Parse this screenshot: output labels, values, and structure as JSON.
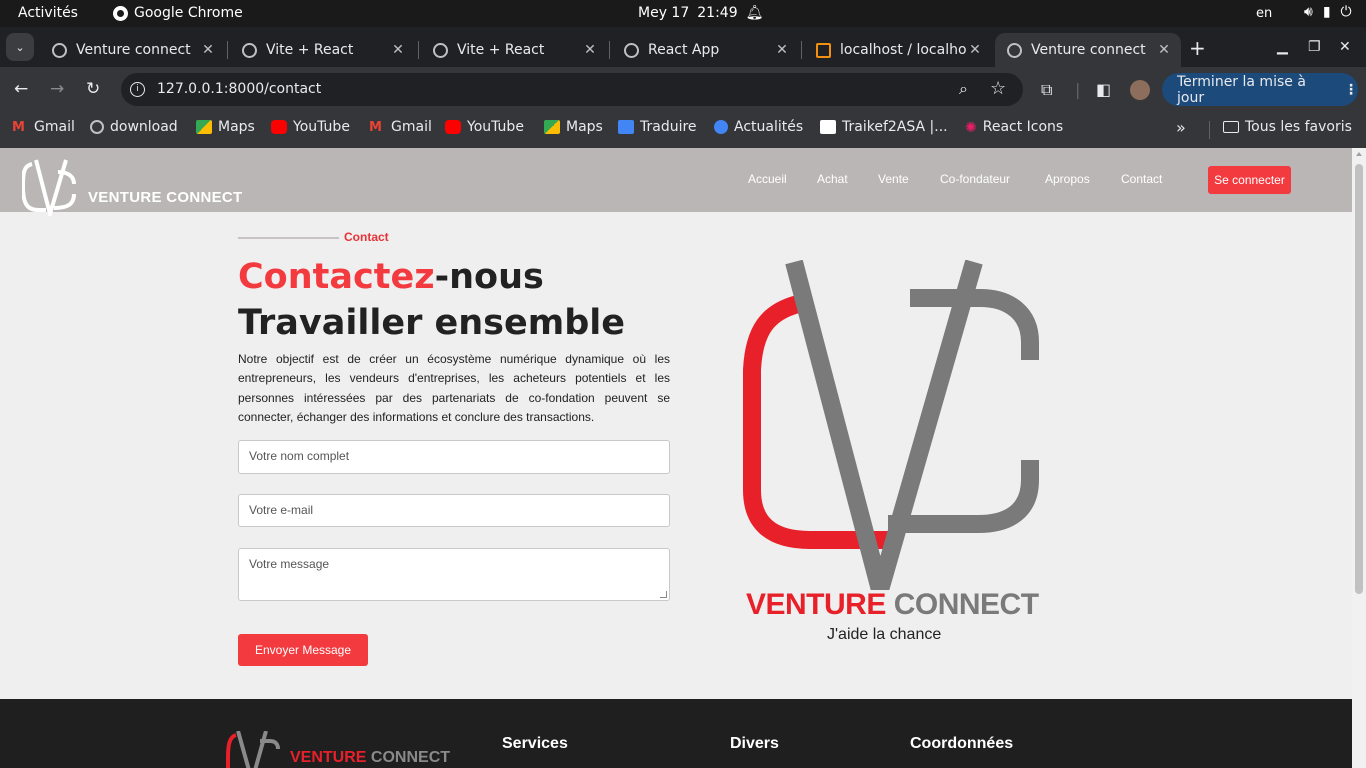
{
  "system": {
    "activities": "Activités",
    "app_name": "Google Chrome",
    "date": "Mey 17",
    "time": "21:49",
    "lang": "en"
  },
  "tabs": [
    {
      "title": "Venture connect",
      "active": false
    },
    {
      "title": "Vite + React",
      "active": false
    },
    {
      "title": "Vite + React",
      "active": false
    },
    {
      "title": "React App",
      "active": false
    },
    {
      "title": "localhost / localho",
      "active": false
    },
    {
      "title": "Venture connect",
      "active": true
    }
  ],
  "toolbar": {
    "url": "127.0.0.1:8000/contact",
    "update_label": "Terminer la mise à jour"
  },
  "bookmarks": [
    {
      "label": "Gmail",
      "icon": "gmail-icon",
      "color": "#ea4335"
    },
    {
      "label": "download",
      "icon": "globe-icon",
      "color": "#bdc1c6"
    },
    {
      "label": "Maps",
      "icon": "maps-icon",
      "color": "#34a853"
    },
    {
      "label": "YouTube",
      "icon": "youtube-icon",
      "color": "#ff0000"
    },
    {
      "label": "Gmail",
      "icon": "gmail-icon",
      "color": "#ea4335"
    },
    {
      "label": "YouTube",
      "icon": "youtube-icon",
      "color": "#ff0000"
    },
    {
      "label": "Maps",
      "icon": "maps-icon",
      "color": "#34a853"
    },
    {
      "label": "Traduire",
      "icon": "translate-icon",
      "color": "#4285f4"
    },
    {
      "label": "Actualités",
      "icon": "news-icon",
      "color": "#4285f4"
    },
    {
      "label": "Traikef2ASA |...",
      "icon": "tt-icon",
      "color": "#ffffff"
    },
    {
      "label": "React Icons",
      "icon": "react-icon",
      "color": "#e91e63"
    }
  ],
  "all_bookmarks": "Tous les favoris",
  "site": {
    "brand": "VENTURE CONNECT",
    "nav": [
      "Accueil",
      "Achat",
      "Vente",
      "Co-fondateur",
      "Apropos",
      "Contact"
    ],
    "login": "Se connecter",
    "section_label": "Contact",
    "heading_red": "Contactez",
    "heading_rest": "-nous",
    "heading_line2": "Travailler ensemble",
    "lead": "Notre objectif est de créer un écosystème numérique dynamique où les entrepreneurs, les vendeurs d'entreprises, les acheteurs potentiels et les personnes intéressées par des partenariats de co-fondation peuvent se connecter, échanger des informations et conclure des transactions.",
    "form": {
      "name_placeholder": "Votre nom complet",
      "email_placeholder": "Votre e-mail",
      "message_placeholder": "Votre message",
      "submit": "Envoyer Message"
    },
    "logo_brand_red": "VENTURE",
    "logo_brand_gray": "CONNECT",
    "tagline": "J'aide la chance",
    "footer": {
      "brand_red": "VENTURE",
      "brand_gray": "CONNECT",
      "columns": [
        "Services",
        "Divers",
        "Coordonnées"
      ]
    }
  },
  "colors": {
    "accent": "#f33a3f",
    "nav_bg": "#bab6b6",
    "logo_gray": "#7a7a7a"
  }
}
